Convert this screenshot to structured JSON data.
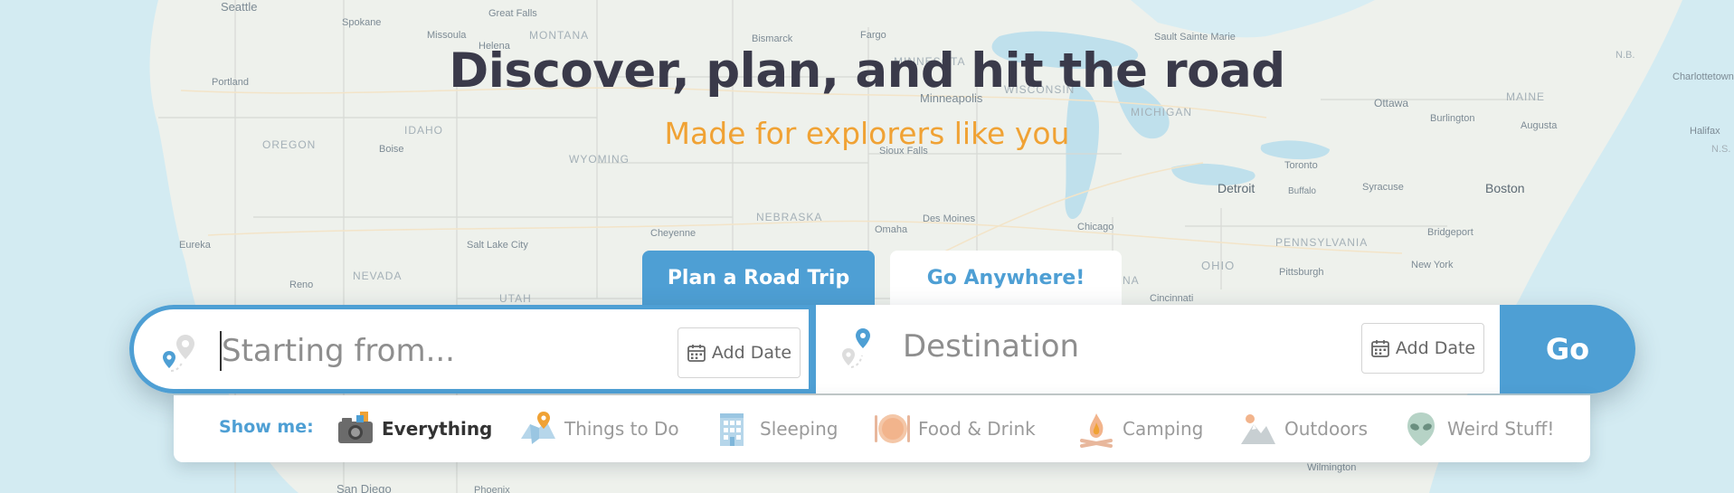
{
  "map": {
    "labels": [
      {
        "text": "Seattle",
        "cls": "city"
      },
      {
        "text": "Spokane",
        "cls": "city"
      },
      {
        "text": "Great Falls",
        "cls": "city"
      },
      {
        "text": "MONTANA",
        "cls": "state"
      },
      {
        "text": "Missoula",
        "cls": "city"
      },
      {
        "text": "Helena",
        "cls": "city"
      },
      {
        "text": "Bismarck",
        "cls": "city"
      },
      {
        "text": "Fargo",
        "cls": "city"
      },
      {
        "text": "MINNESOTA",
        "cls": "state"
      },
      {
        "text": "Minneapolis",
        "cls": "city"
      },
      {
        "text": "WISCONSIN",
        "cls": "state"
      },
      {
        "text": "MICHIGAN",
        "cls": "state"
      },
      {
        "text": "Sault Sainte Marie",
        "cls": "city"
      },
      {
        "text": "Portland",
        "cls": "city"
      },
      {
        "text": "OREGON",
        "cls": "state"
      },
      {
        "text": "IDAHO",
        "cls": "state"
      },
      {
        "text": "Boise",
        "cls": "city"
      },
      {
        "text": "WYOMING",
        "cls": "state"
      },
      {
        "text": "Sioux Falls",
        "cls": "city"
      },
      {
        "text": "Ottawa",
        "cls": "city"
      },
      {
        "text": "Burlington",
        "cls": "city"
      },
      {
        "text": "MAINE",
        "cls": "state"
      },
      {
        "text": "Augusta",
        "cls": "city"
      },
      {
        "text": "Halifax",
        "cls": "city"
      },
      {
        "text": "Charlottetown",
        "cls": "city"
      },
      {
        "text": "N.B.",
        "cls": "state"
      },
      {
        "text": "N.S.",
        "cls": "state"
      },
      {
        "text": "Toronto",
        "cls": "city"
      },
      {
        "text": "Buffalo",
        "cls": "city"
      },
      {
        "text": "Syracuse",
        "cls": "city"
      },
      {
        "text": "Detroit",
        "cls": "city-big"
      },
      {
        "text": "Boston",
        "cls": "city-big"
      },
      {
        "text": "NEBRASKA",
        "cls": "state"
      },
      {
        "text": "Des Moines",
        "cls": "city"
      },
      {
        "text": "Omaha",
        "cls": "city"
      },
      {
        "text": "Cheyenne",
        "cls": "city"
      },
      {
        "text": "Chicago",
        "cls": "city"
      },
      {
        "text": "PENNSYLVANIA",
        "cls": "state"
      },
      {
        "text": "Bridgeport",
        "cls": "city"
      },
      {
        "text": "New York",
        "cls": "city"
      },
      {
        "text": "Pittsburgh",
        "cls": "city"
      },
      {
        "text": "OHIO",
        "cls": "state"
      },
      {
        "text": "Cincinnati",
        "cls": "city"
      },
      {
        "text": "DIANA",
        "cls": "state"
      },
      {
        "text": "Eureka",
        "cls": "city"
      },
      {
        "text": "Salt Lake City",
        "cls": "city"
      },
      {
        "text": "NEVADA",
        "cls": "state"
      },
      {
        "text": "Reno",
        "cls": "city"
      },
      {
        "text": "UTAH",
        "cls": "state"
      },
      {
        "text": "San Diego",
        "cls": "city"
      },
      {
        "text": "Phoenix",
        "cls": "city"
      },
      {
        "text": "Wilmington",
        "cls": "city"
      }
    ]
  },
  "hero": {
    "title": "Discover, plan, and hit the road",
    "subtitle": "Made for explorers like you"
  },
  "tabs": [
    {
      "label": "Plan a Road Trip",
      "active": true
    },
    {
      "label": "Go Anywhere!",
      "active": false
    }
  ],
  "search": {
    "origin_placeholder": "Starting from...",
    "destination_placeholder": "Destination",
    "add_date_label": "Add Date",
    "go_label": "Go"
  },
  "filters": {
    "label": "Show me:",
    "items": [
      {
        "label": "Everything",
        "icon": "camera-icon",
        "active": true
      },
      {
        "label": "Things to Do",
        "icon": "map-pin-icon",
        "active": false
      },
      {
        "label": "Sleeping",
        "icon": "hotel-icon",
        "active": false
      },
      {
        "label": "Food & Drink",
        "icon": "plate-icon",
        "active": false
      },
      {
        "label": "Camping",
        "icon": "campfire-icon",
        "active": false
      },
      {
        "label": "Outdoors",
        "icon": "mountain-icon",
        "active": false
      },
      {
        "label": "Weird Stuff!",
        "icon": "alien-icon",
        "active": false
      }
    ]
  },
  "colors": {
    "accent": "#4e9fd4",
    "subtitle": "#f0a234",
    "title": "#3a3a4a",
    "water": "#cde6ef",
    "land": "#eef1ec"
  }
}
